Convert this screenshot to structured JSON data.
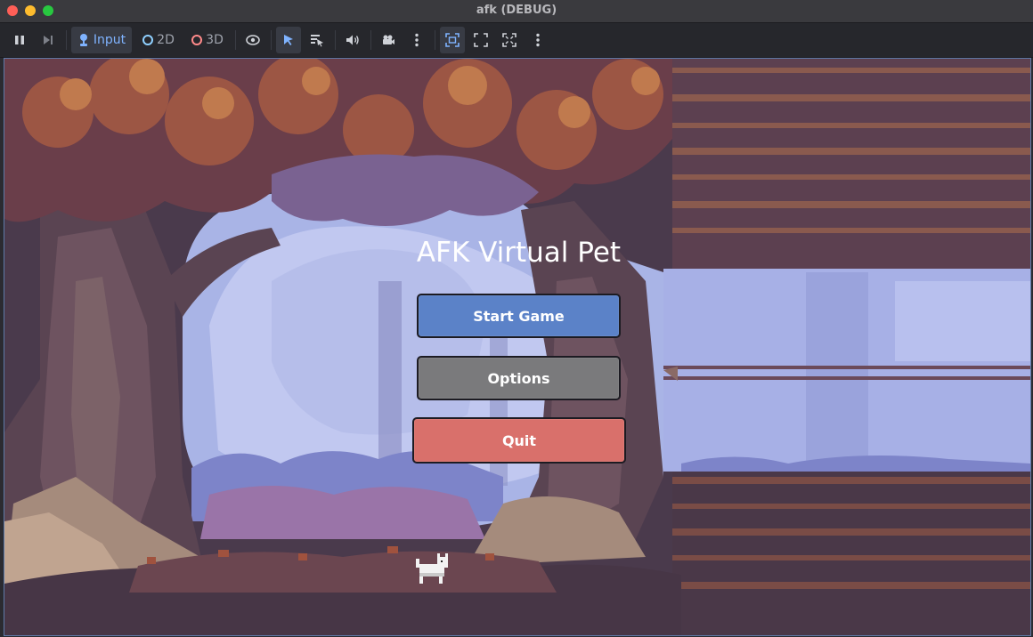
{
  "window": {
    "title": "afk (DEBUG)"
  },
  "toolbar": {
    "pause_icon": "pause-icon",
    "step_icon": "next-frame-icon",
    "input_label": "Input",
    "mode_2d_label": "2D",
    "mode_3d_label": "3D",
    "colors": {
      "accent": "#7fb3ff",
      "ring_2d": "#8fd0ff",
      "ring_3d": "#ff8a8a"
    }
  },
  "game": {
    "title": "AFK Virtual Pet",
    "buttons": {
      "start": "Start Game",
      "options": "Options",
      "quit": "Quit"
    },
    "colors": {
      "start": "#5b82c8",
      "options": "#7a7a7c",
      "quit": "#d9706b"
    }
  }
}
